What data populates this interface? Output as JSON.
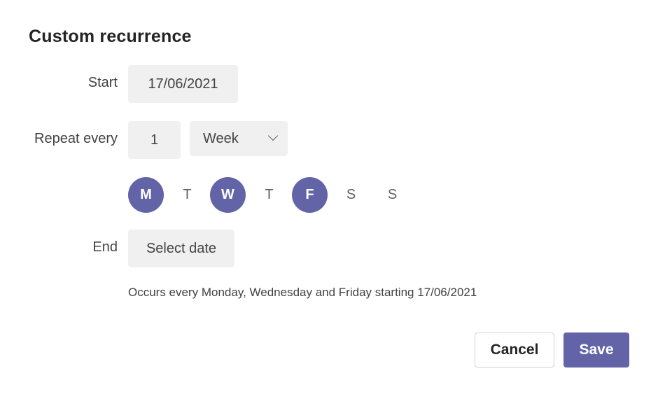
{
  "dialog": {
    "title": "Custom recurrence",
    "start": {
      "label": "Start",
      "value": "17/06/2021"
    },
    "repeat": {
      "label": "Repeat every",
      "interval": "1",
      "unit": "Week"
    },
    "days": [
      {
        "label": "M",
        "selected": true
      },
      {
        "label": "T",
        "selected": false
      },
      {
        "label": "W",
        "selected": true
      },
      {
        "label": "T",
        "selected": false
      },
      {
        "label": "F",
        "selected": true
      },
      {
        "label": "S",
        "selected": false
      },
      {
        "label": "S",
        "selected": false
      }
    ],
    "end": {
      "label": "End",
      "placeholder": "Select date"
    },
    "summary": "Occurs every Monday, Wednesday and Friday starting 17/06/2021",
    "buttons": {
      "cancel": "Cancel",
      "save": "Save"
    },
    "accent_color": "#6264a7"
  }
}
